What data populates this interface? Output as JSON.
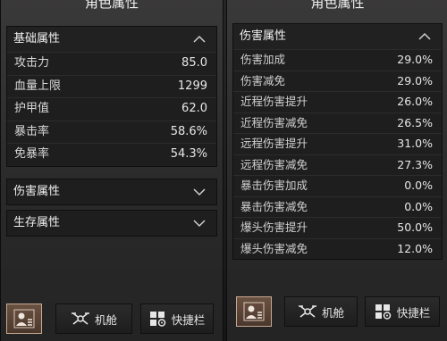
{
  "left_panel": {
    "title": "角色属性",
    "basic": {
      "label": "基础属性",
      "rows": [
        {
          "label": "攻击力",
          "value": "85.0"
        },
        {
          "label": "血量上限",
          "value": "1299"
        },
        {
          "label": "护甲值",
          "value": "62.0"
        },
        {
          "label": "暴击率",
          "value": "58.6%"
        },
        {
          "label": "免暴率",
          "value": "54.3%"
        }
      ]
    },
    "damage_section": "伤害属性",
    "survival_section": "生存属性"
  },
  "right_panel": {
    "title": "角色属性",
    "damage": {
      "label": "伤害属性",
      "rows": [
        {
          "label": "伤害加成",
          "value": "29.0%"
        },
        {
          "label": "伤害减免",
          "value": "29.0%"
        },
        {
          "label": "近程伤害提升",
          "value": "26.0%"
        },
        {
          "label": "近程伤害减免",
          "value": "26.5%"
        },
        {
          "label": "远程伤害提升",
          "value": "31.0%"
        },
        {
          "label": "远程伤害减免",
          "value": "27.3%"
        },
        {
          "label": "暴击伤害加成",
          "value": "0.0%"
        },
        {
          "label": "暴击伤害减免",
          "value": "0.0%"
        },
        {
          "label": "爆头伤害提升",
          "value": "50.0%"
        },
        {
          "label": "爆头伤害减免",
          "value": "12.0%"
        }
      ]
    }
  },
  "tabs": {
    "cabin": "机舱",
    "hotbar": "快捷栏"
  },
  "colors": {
    "active_tab_border": "#c9a991",
    "active_tab_fill": "#5a4436"
  },
  "icons": [
    "character-icon",
    "drone-icon",
    "hotbar-icon",
    "chevron-up-icon",
    "chevron-down-icon"
  ]
}
